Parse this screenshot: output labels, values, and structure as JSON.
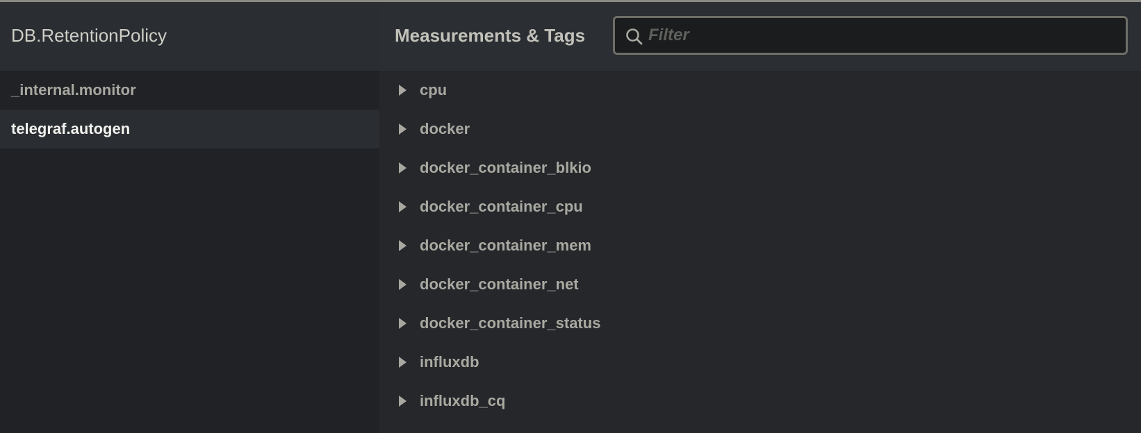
{
  "left_panel": {
    "title": "DB.RetentionPolicy",
    "items": [
      {
        "label": "_internal.monitor",
        "active": false
      },
      {
        "label": "telegraf.autogen",
        "active": true
      }
    ]
  },
  "right_panel": {
    "title": "Measurements & Tags",
    "filter": {
      "placeholder": "Filter",
      "value": "",
      "icon": "search-icon"
    },
    "measurements": [
      {
        "label": "cpu",
        "icon": "caret-right-icon"
      },
      {
        "label": "docker",
        "icon": "caret-right-icon"
      },
      {
        "label": "docker_container_blkio",
        "icon": "caret-right-icon"
      },
      {
        "label": "docker_container_cpu",
        "icon": "caret-right-icon"
      },
      {
        "label": "docker_container_mem",
        "icon": "caret-right-icon"
      },
      {
        "label": "docker_container_net",
        "icon": "caret-right-icon"
      },
      {
        "label": "docker_container_status",
        "icon": "caret-right-icon"
      },
      {
        "label": "influxdb",
        "icon": "caret-right-icon"
      },
      {
        "label": "influxdb_cq",
        "icon": "caret-right-icon"
      }
    ]
  },
  "colors": {
    "background": "#25272b",
    "panel_header": "#2b2e32",
    "text_muted": "#a8a8a0",
    "text_active": "#f2f2ee",
    "filter_border": "#6e6e68"
  }
}
